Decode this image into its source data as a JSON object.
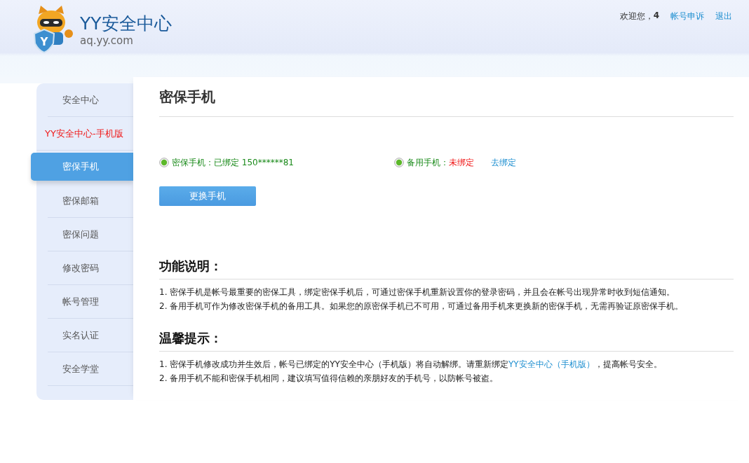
{
  "header": {
    "logo_badge": "Y",
    "title": "YY安全中心",
    "domain": "aq.yy.com",
    "welcome": "欢迎您，",
    "user": "4",
    "links": [
      "帐号申诉",
      "退出"
    ]
  },
  "sidebar": {
    "items": [
      {
        "label": "安全中心",
        "kind": "normal",
        "selected": false
      },
      {
        "label": "YY安全中心-手机版",
        "kind": "promo",
        "selected": false
      },
      {
        "label": "密保手机",
        "kind": "normal",
        "selected": true
      },
      {
        "label": "密保邮箱",
        "kind": "normal",
        "selected": false
      },
      {
        "label": "密保问题",
        "kind": "normal",
        "selected": false
      },
      {
        "label": "修改密码",
        "kind": "normal",
        "selected": false
      },
      {
        "label": "帐号管理",
        "kind": "normal",
        "selected": false
      },
      {
        "label": "实名认证",
        "kind": "normal",
        "selected": false
      },
      {
        "label": "安全学堂",
        "kind": "normal",
        "selected": false
      }
    ]
  },
  "content": {
    "title": "密保手机",
    "phones": [
      {
        "label": "密保手机：",
        "value": "已绑定 150******81",
        "bound": true
      },
      {
        "label": "备用手机：",
        "value": "未绑定",
        "bound": false,
        "action": "去绑定"
      }
    ],
    "button": "更换手机",
    "sections": [
      {
        "heading": "功能说明：",
        "lines": [
          {
            "text": "1. 密保手机是帐号最重要的密保工具，绑定密保手机后，可通过密保手机重新设置你的登录密码，并且会在帐号出现异常时收到短信通知。"
          },
          {
            "text": "2. 备用手机可作为修改密保手机的备用工具。如果您的原密保手机已不可用，可通过备用手机来更换新的密保手机，无需再验证原密保手机。"
          }
        ]
      },
      {
        "heading": "温馨提示：",
        "lines": [
          {
            "text": "1. 密保手机修改成功并生效后，帐号已绑定的YY安全中心（手机版）将自动解绑。请重新绑定",
            "link": "YY安全中心（手机版）",
            "after": "，提高帐号安全。"
          },
          {
            "text": "2. 备用手机不能和密保手机相同，建议填写值得信赖的亲朋好友的手机号，以防帐号被盗。"
          }
        ]
      }
    ]
  }
}
